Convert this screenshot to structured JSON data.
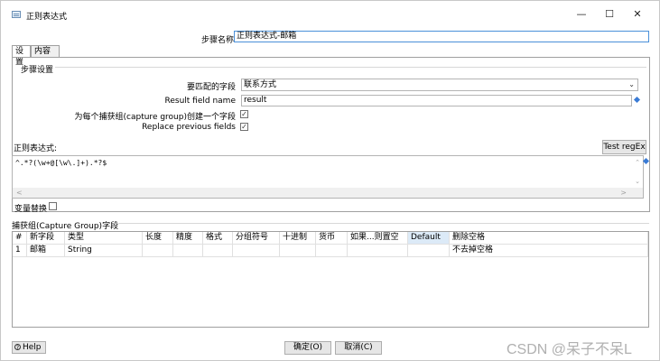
{
  "window": {
    "title": "正则表达式",
    "icon": "regex-window-icon",
    "minimize": "—",
    "maximize": "☐",
    "close": "✕"
  },
  "step": {
    "label": "步骤名称",
    "value": "正则表达式-邮箱"
  },
  "tabs": [
    {
      "label": "设置",
      "active": true
    },
    {
      "label": "内容",
      "active": false
    }
  ],
  "settings": {
    "group_title": "步骤设置",
    "match_field_label": "要匹配的字段",
    "match_field_value": "联系方式",
    "result_field_label": "Result field name",
    "result_field_value": "result",
    "capture_label": "为每个捕获组(capture group)创建一个字段",
    "capture_checked": "✓",
    "replace_label": "Replace previous fields",
    "replace_checked": "✓"
  },
  "regex": {
    "label": "正则表达式:",
    "test_button": "Test regEx",
    "value": "^.*?(\\w+@[\\w\\.]+).*?$"
  },
  "var_sub": {
    "label": "变量替换",
    "checked": ""
  },
  "capture_groups": {
    "label": "捕获组(Capture Group)字段",
    "columns": [
      "#",
      "新字段",
      "类型",
      "长度",
      "精度",
      "格式",
      "分组符号",
      "十进制",
      "货币",
      "如果...则置空",
      "Default",
      "删除空格"
    ],
    "rows": [
      [
        "1",
        "邮箱",
        "String",
        "",
        "",
        "",
        "",
        "",
        "",
        "",
        "",
        "不去掉空格"
      ]
    ]
  },
  "footer": {
    "help": "Help",
    "ok": "确定(O)",
    "cancel": "取消(C)"
  },
  "watermark": "CSDN @呆子不呆L"
}
